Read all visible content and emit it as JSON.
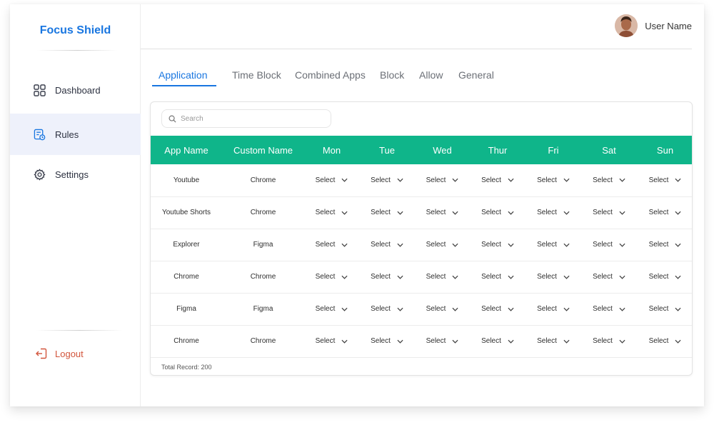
{
  "brand": "Focus Shield",
  "sidebar": {
    "items": [
      {
        "label": "Dashboard",
        "icon": "grid-icon"
      },
      {
        "label": "Rules",
        "icon": "rules-icon",
        "active": true
      },
      {
        "label": "Settings",
        "icon": "gear-icon"
      }
    ],
    "logout_label": "Logout"
  },
  "header": {
    "user_name": "User Name"
  },
  "tabs": [
    "Application",
    "Time Block",
    "Combined Apps",
    "Block",
    "Allow",
    "General"
  ],
  "search": {
    "placeholder": "Search"
  },
  "table": {
    "columns": [
      "App Name",
      "Custom Name",
      "Mon",
      "Tue",
      "Wed",
      "Thur",
      "Fri",
      "Sat",
      "Sun"
    ],
    "rows": [
      {
        "app": "Youtube",
        "custom": "Chrome",
        "days": [
          "Select",
          "Select",
          "Select",
          "Select",
          "Select",
          "Select",
          "Select"
        ]
      },
      {
        "app": "Youtube Shorts",
        "custom": "Chrome",
        "days": [
          "Select",
          "Select",
          "Select",
          "Select",
          "Select",
          "Select",
          "Select"
        ]
      },
      {
        "app": "Explorer",
        "custom": "Figma",
        "days": [
          "Select",
          "Select",
          "Select",
          "Select",
          "Select",
          "Select",
          "Select"
        ]
      },
      {
        "app": "Chrome",
        "custom": "Chrome",
        "days": [
          "Select",
          "Select",
          "Select",
          "Select",
          "Select",
          "Select",
          "Select"
        ]
      },
      {
        "app": "Figma",
        "custom": "Figma",
        "days": [
          "Select",
          "Select",
          "Select",
          "Select",
          "Select",
          "Select",
          "Select"
        ]
      },
      {
        "app": "Chrome",
        "custom": "Chrome",
        "days": [
          "Select",
          "Select",
          "Select",
          "Select",
          "Select",
          "Select",
          "Select"
        ]
      }
    ],
    "footer": "Total Record: 200"
  },
  "colors": {
    "brand": "#1976e0",
    "header": "#0fb58a",
    "logout": "#d2553c",
    "active_bg": "#eef1fb"
  }
}
